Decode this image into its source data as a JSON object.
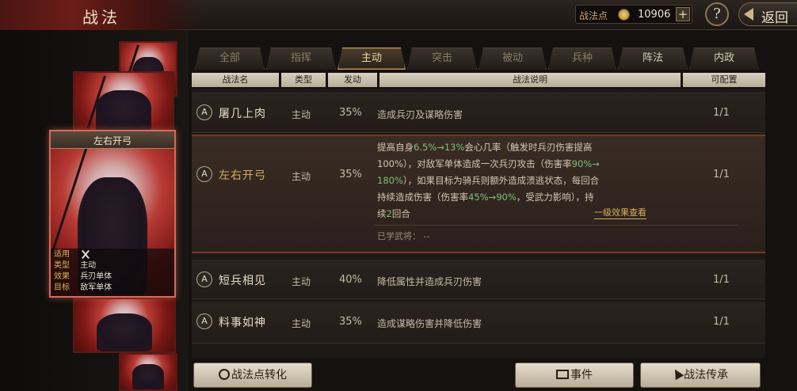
{
  "header": {
    "title": "战法",
    "points_label": "战法点",
    "points_value": "10906",
    "plus_label": "+",
    "help_label": "?",
    "back_label": "返回"
  },
  "card": {
    "title": "左右开弓",
    "info": [
      {
        "key": "适用",
        "value": "",
        "icon": "bow-icon"
      },
      {
        "key": "类型",
        "value": "主动"
      },
      {
        "key": "效果",
        "value": "兵刃单体"
      },
      {
        "key": "目标",
        "value": "敌军单体"
      }
    ]
  },
  "tabs": [
    {
      "label": "全部",
      "active": false
    },
    {
      "label": "指挥",
      "active": false
    },
    {
      "label": "主动",
      "active": true
    },
    {
      "label": "突击",
      "active": false
    },
    {
      "label": "被动",
      "active": false
    },
    {
      "label": "兵种",
      "active": false
    },
    {
      "label": "阵法",
      "active": false
    },
    {
      "label": "内政",
      "active": false
    }
  ],
  "columns": {
    "name": "战法名",
    "type": "类型",
    "rate": "发动",
    "desc": "战法说明",
    "config": "可配置"
  },
  "rows": [
    {
      "badge": "A",
      "name": "屠几上肉",
      "type": "主动",
      "rate": "35%",
      "desc": "造成兵刃及谋略伤害",
      "config": "1/1"
    },
    {
      "badge": "A",
      "name": "左右开弓",
      "type": "主动",
      "rate": "35%",
      "config": "1/1",
      "desc_lines": [
        [
          "提高自身",
          "6.5%→13%",
          "会心几率（触发时兵刃伤害提高"
        ],
        [
          "100%），对敌军单体造成一次兵刃攻击（伤害率",
          "90%→",
          ""
        ],
        [
          "",
          "180%",
          "），如果目标为骑兵则额外造成溃逃状态，每回合"
        ],
        [
          "持续造成伤害（伤害率",
          "45%→90%",
          "，受武力影响），持"
        ],
        [
          "续",
          "2",
          "回合"
        ]
      ],
      "level_link": "一级效果查看",
      "learned": "已学武将：  --"
    },
    {
      "badge": "A",
      "name": "短兵相见",
      "type": "主动",
      "rate": "40%",
      "desc": "降低属性并造成兵刃伤害",
      "config": "1/1"
    },
    {
      "badge": "A",
      "name": "料事如神",
      "type": "主动",
      "rate": "35%",
      "desc": "造成谋略伤害并降低伤害",
      "config": "1/1"
    }
  ],
  "buttons": {
    "convert": "战法点转化",
    "event": "事件",
    "inherit": "战法传承"
  },
  "colors": {
    "accent_gold": "#d8ae5c",
    "highlight_green": "#7fc07a",
    "card_red": "#b83a34"
  }
}
